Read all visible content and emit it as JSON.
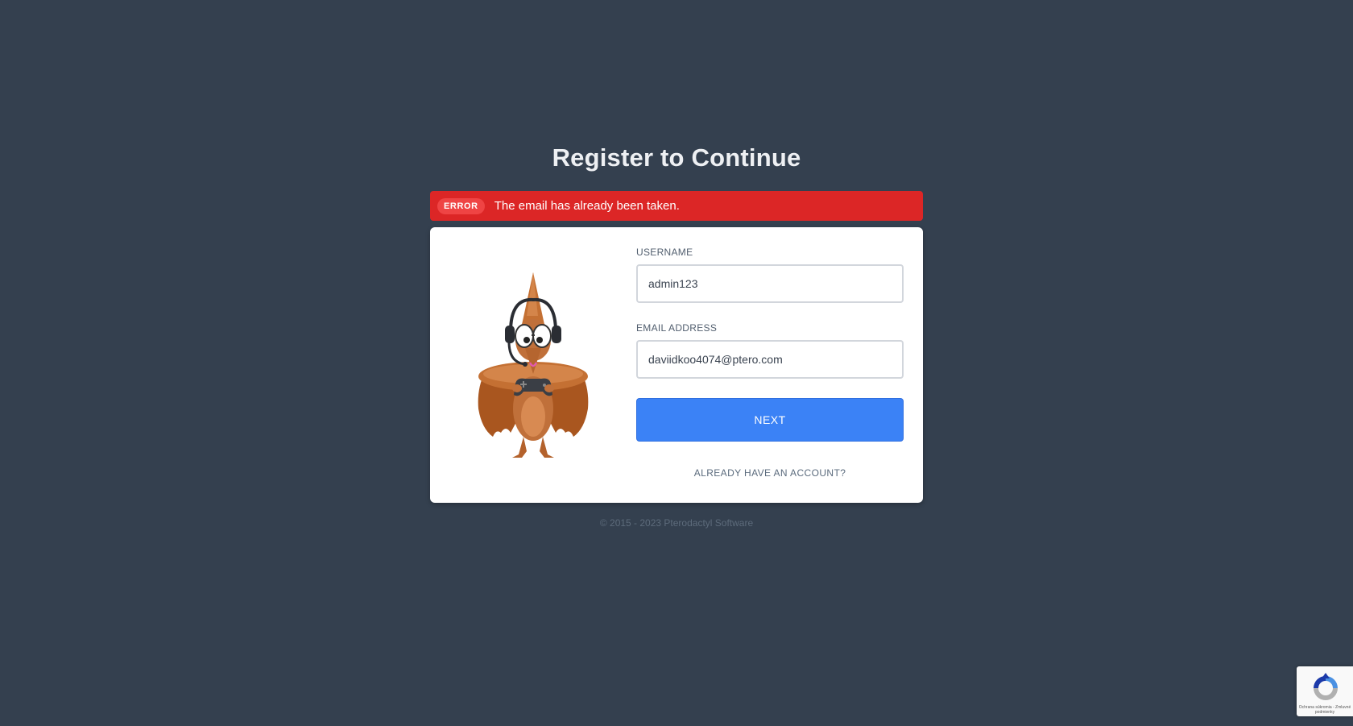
{
  "page": {
    "title": "Register to Continue"
  },
  "alert": {
    "badge": "ERROR",
    "message": "The email has already been taken."
  },
  "form": {
    "username_label": "USERNAME",
    "username_value": "admin123",
    "email_label": "EMAIL ADDRESS",
    "email_value": "daviidkoo4074@ptero.com",
    "next_label": "NEXT",
    "login_link": "ALREADY HAVE AN ACCOUNT?"
  },
  "footer": {
    "copyright": "© 2015 - 2023 Pterodactyl Software"
  },
  "recaptcha": {
    "text": "Ochrana súkromia - Zmluvné podmienky",
    "icon": "recaptcha-icon"
  },
  "colors": {
    "background": "#34404f",
    "error": "#dc2626",
    "primary_button": "#3b82f6",
    "mascot_body": "#c0703a"
  }
}
